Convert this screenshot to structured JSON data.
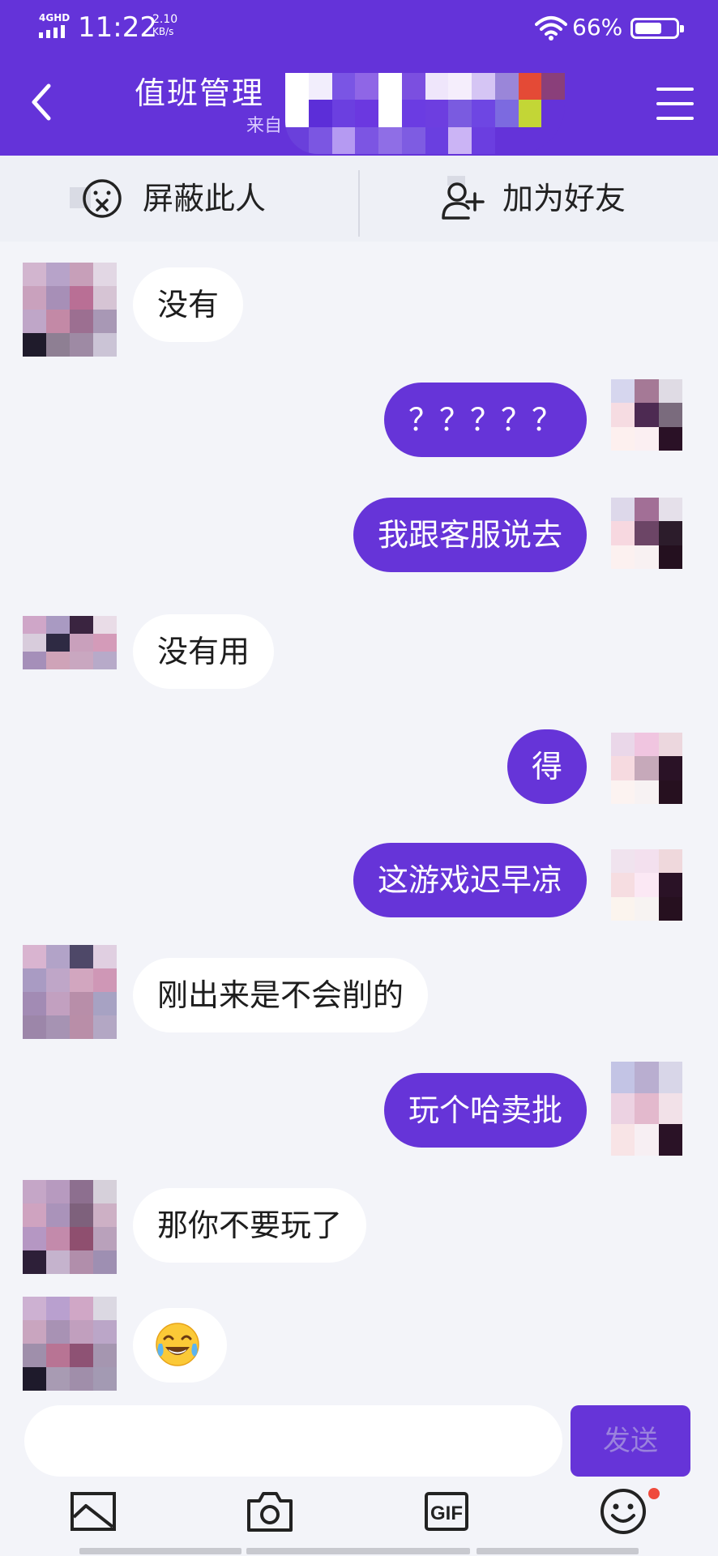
{
  "status_bar": {
    "network": "4GHD",
    "time": "11:22",
    "speed_value": "2.10",
    "speed_unit": "KB/s",
    "battery_percent_label": "66%",
    "battery_level": 0.66
  },
  "header": {
    "title": "值班管理",
    "subtitle": "来自",
    "back_icon": "chevron-left-icon",
    "menu_icon": "hamburger-menu-icon"
  },
  "actions": {
    "block_label": "屏蔽此人",
    "block_icon": "blocked-face-icon",
    "add_friend_label": "加为好友",
    "add_friend_icon": "add-user-icon"
  },
  "messages": [
    {
      "side": "in",
      "text": "没有"
    },
    {
      "side": "out",
      "text": "？？？？？"
    },
    {
      "side": "out",
      "text": "我跟客服说去"
    },
    {
      "side": "in",
      "text": "没有用"
    },
    {
      "side": "out",
      "text": "得"
    },
    {
      "side": "out",
      "text": "这游戏迟早凉"
    },
    {
      "side": "in",
      "text": "刚出来是不会削的"
    },
    {
      "side": "out",
      "text": "玩个哈卖批"
    },
    {
      "side": "in",
      "text": "那你不要玩了"
    },
    {
      "side": "in",
      "text": "",
      "emoji": "tears-of-joy-emoji"
    }
  ],
  "composer": {
    "input_value": "",
    "send_label": "发送"
  },
  "toolbar": {
    "icons": [
      "image-icon",
      "camera-icon",
      "gif-icon",
      "emoji-smile-icon"
    ],
    "gif_text": "GIF"
  },
  "colors": {
    "brand": "#6433d9",
    "bubble_out": "#6634d8",
    "bubble_in": "#ffffff",
    "background": "#f3f4f9",
    "badge": "#ef4a3c"
  }
}
